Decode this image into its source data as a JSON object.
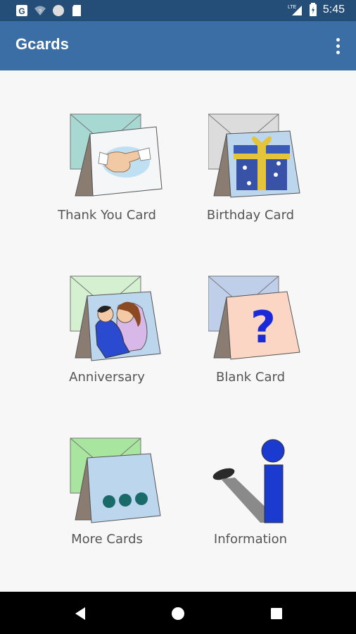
{
  "status_bar": {
    "time": "5:45",
    "network": "LTE",
    "icons": [
      "g-notification-icon",
      "wifi-icon",
      "circle-icon",
      "sd-card-icon",
      "signal-icon",
      "battery-icon"
    ]
  },
  "app_bar": {
    "title": "Gcards",
    "menu_icon": "more-vert-icon"
  },
  "tiles": [
    {
      "label": "Thank You Card",
      "icon": "handshake-card-icon"
    },
    {
      "label": "Birthday Card",
      "icon": "gift-card-icon"
    },
    {
      "label": "Anniversary",
      "icon": "couple-card-icon"
    },
    {
      "label": "Blank Card",
      "icon": "question-card-icon"
    },
    {
      "label": "More Cards",
      "icon": "dots-card-icon"
    },
    {
      "label": "Information",
      "icon": "info-icon"
    }
  ],
  "nav_bar": {
    "buttons": [
      "back-icon",
      "home-icon",
      "recents-icon"
    ]
  },
  "colors": {
    "status_bar": "#244d78",
    "app_bar": "#3a6ea5",
    "background": "#f7f7f7",
    "label_text": "#555555"
  }
}
